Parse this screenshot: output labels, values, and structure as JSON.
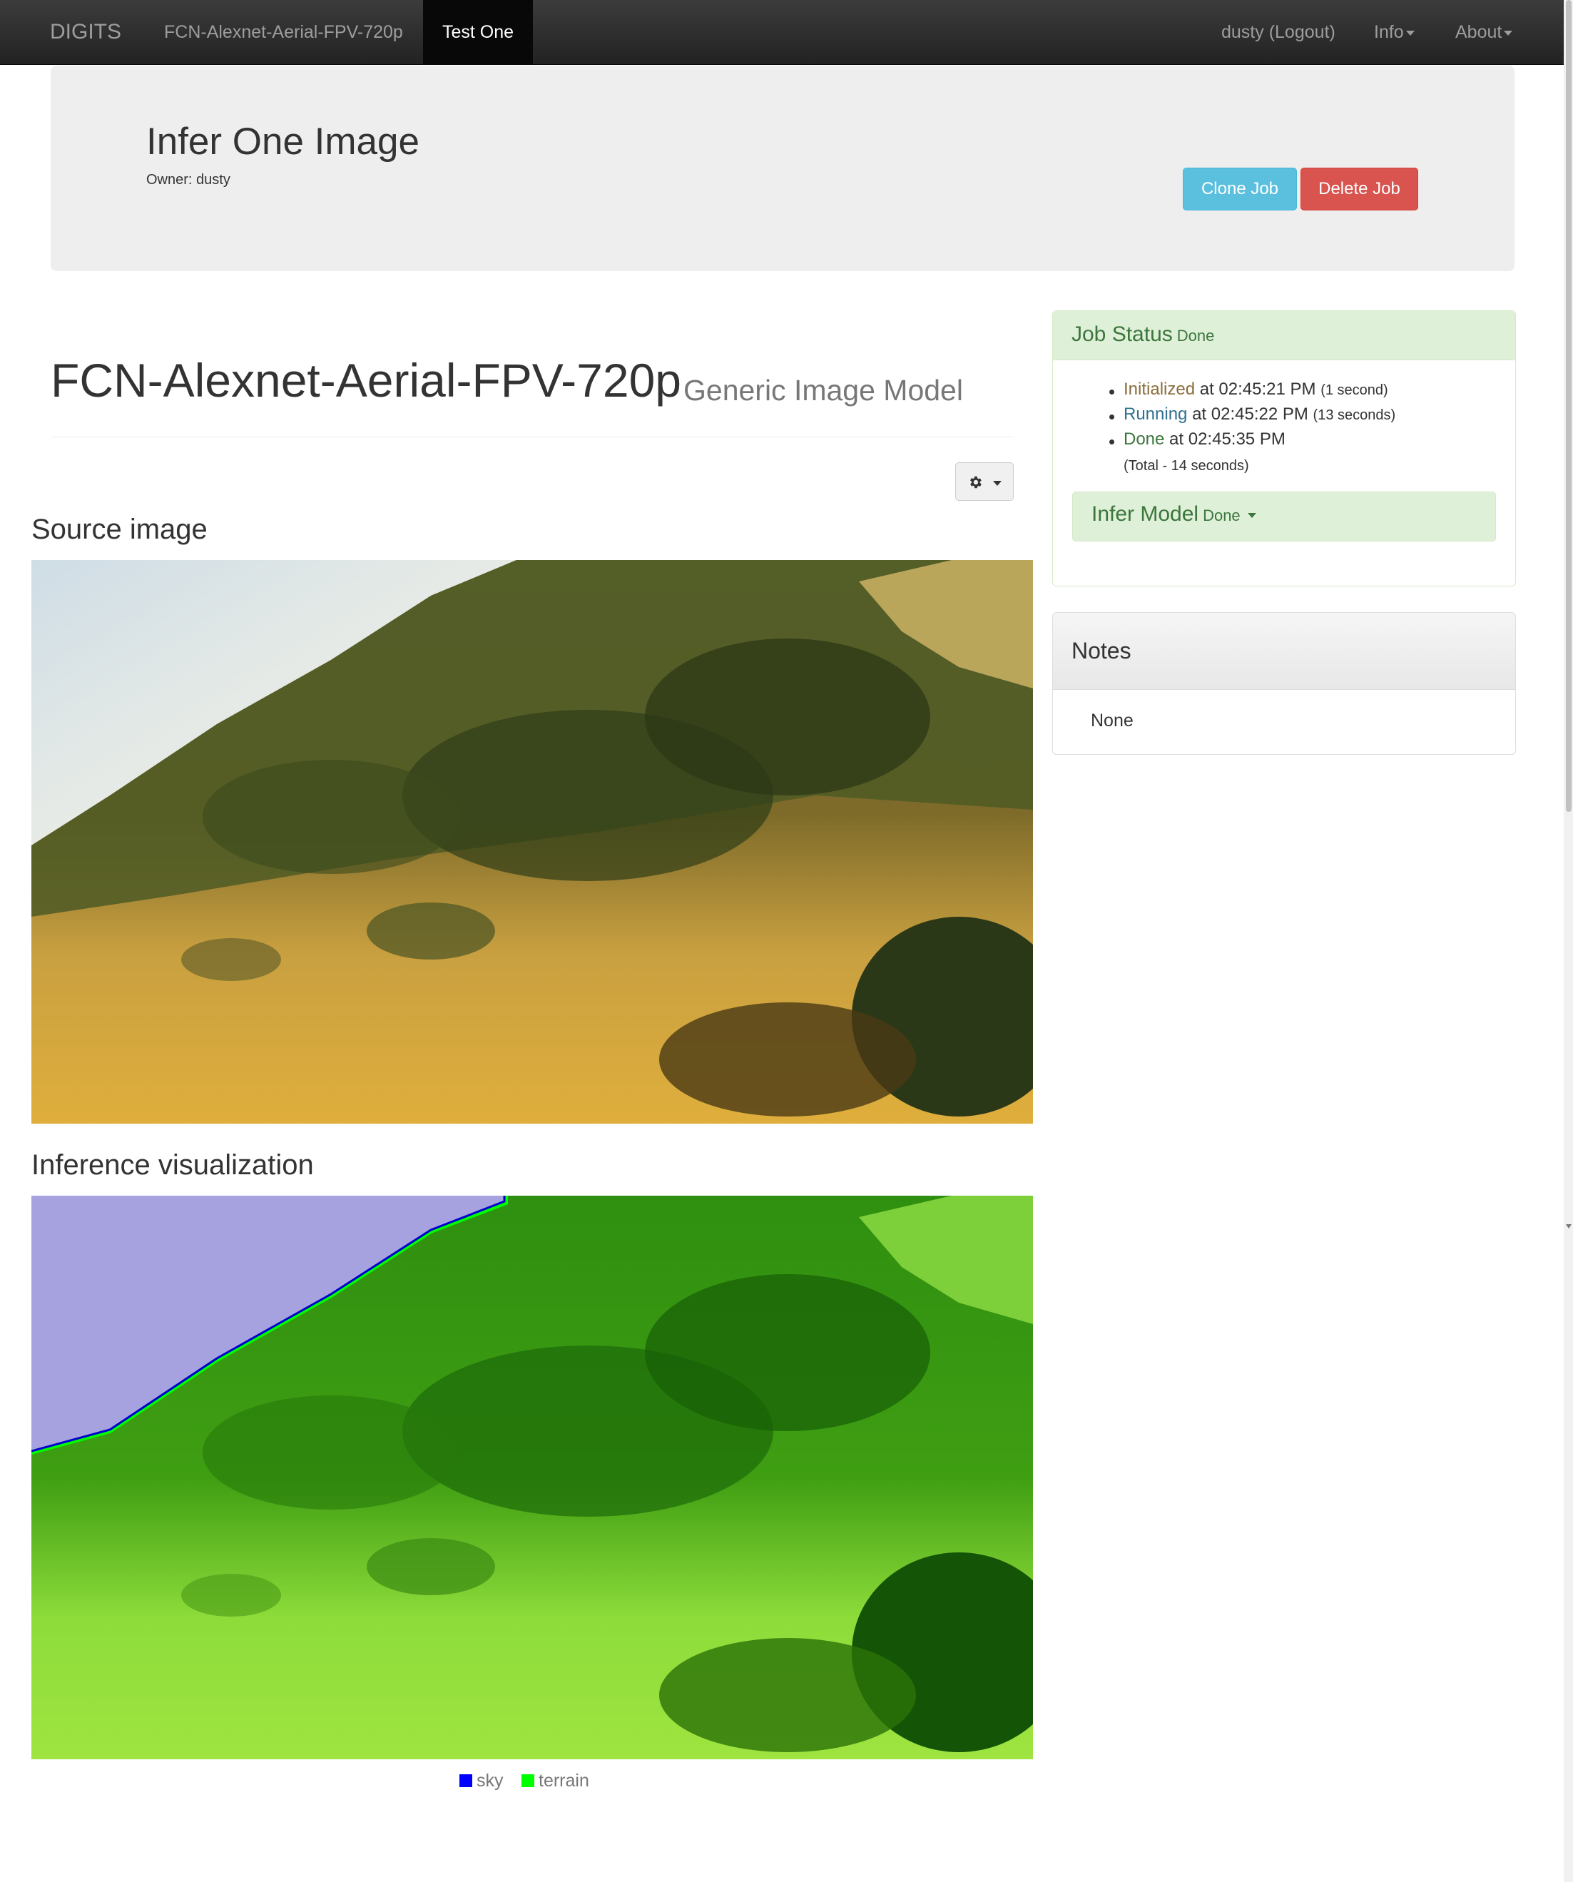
{
  "navbar": {
    "brand": "DIGITS",
    "model_link": "FCN-Alexnet-Aerial-FPV-720p",
    "active_tab": "Test One",
    "user": "dusty (Logout)",
    "info": "Info",
    "about": "About"
  },
  "job": {
    "title": "Infer One Image",
    "owner": "Owner: dusty",
    "clone_label": "Clone Job",
    "delete_label": "Delete Job"
  },
  "model": {
    "name": "FCN-Alexnet-Aerial-FPV-720p",
    "type": "Generic Image Model"
  },
  "sections": {
    "source": "Source image",
    "inference": "Inference visualization"
  },
  "legend": {
    "items": [
      {
        "label": "sky",
        "color": "#0000ff"
      },
      {
        "label": "terrain",
        "color": "#00ff00"
      }
    ]
  },
  "job_status": {
    "title": "Job Status",
    "state": "Done",
    "rows": [
      {
        "state": "Initialized",
        "text": "at 02:45:21 PM",
        "duration": "(1 second)"
      },
      {
        "state": "Running",
        "text": "at 02:45:22 PM",
        "duration": "(13 seconds)"
      },
      {
        "state": "Done",
        "text": "at 02:45:35 PM",
        "duration": ""
      }
    ],
    "total": "(Total - 14 seconds)",
    "infer_model": "Infer Model",
    "infer_model_state": "Done"
  },
  "notes": {
    "title": "Notes",
    "body": "None"
  },
  "icons": {
    "gear": "gear-icon",
    "caret": "caret-down-icon"
  },
  "colors": {
    "navbar": "#222222",
    "clone": "#5bc0de",
    "delete": "#d9534f",
    "success_bg": "#dff0d8",
    "success_text": "#3c763d"
  }
}
